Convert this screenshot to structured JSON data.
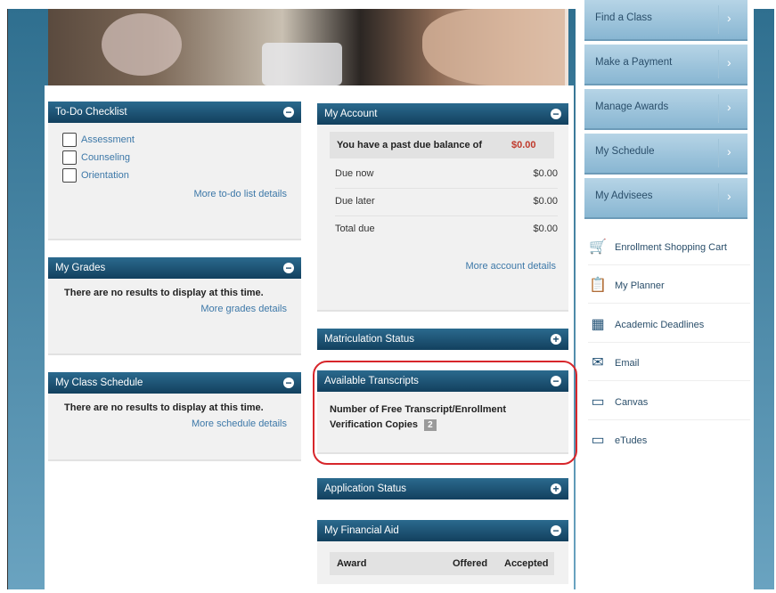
{
  "nav_buttons": [
    {
      "label": "Find a Class"
    },
    {
      "label": "Make a Payment"
    },
    {
      "label": "Manage Awards"
    },
    {
      "label": "My Schedule"
    },
    {
      "label": "My Advisees"
    }
  ],
  "quick_links": [
    {
      "label": "Enrollment Shopping Cart",
      "icon": "cart-icon"
    },
    {
      "label": "My Planner",
      "icon": "planner-icon"
    },
    {
      "label": "Academic Deadlines",
      "icon": "calendar-icon"
    },
    {
      "label": "Email",
      "icon": "email-icon"
    },
    {
      "label": "Canvas",
      "icon": "monitor-icon"
    },
    {
      "label": "eTudes",
      "icon": "monitor-icon"
    }
  ],
  "todo": {
    "title": "To-Do Checklist",
    "items": [
      "Assessment",
      "Counseling",
      "Orientation"
    ],
    "more": "More to-do list details"
  },
  "grades": {
    "title": "My Grades",
    "empty": "There are no results to display at this time.",
    "more": "More grades details"
  },
  "class_schedule": {
    "title": "My Class Schedule",
    "empty": "There are no results to display at this time.",
    "more": "More schedule details"
  },
  "account": {
    "title": "My Account",
    "past_due_text": "You have a past due balance of",
    "past_due_amount": "$0.00",
    "rows": [
      {
        "label": "Due now",
        "amount": "$0.00"
      },
      {
        "label": "Due later",
        "amount": "$0.00"
      },
      {
        "label": "Total due",
        "amount": "$0.00"
      }
    ],
    "more": "More account details"
  },
  "matriculation": {
    "title": "Matriculation Status"
  },
  "transcripts": {
    "title": "Available Transcripts",
    "text": "Number of Free Transcript/Enrollment Verification Copies",
    "count": "2"
  },
  "application": {
    "title": "Application Status"
  },
  "financial_aid": {
    "title": "My Financial Aid",
    "columns": [
      "Award",
      "Offered",
      "Accepted"
    ]
  },
  "colors": {
    "header": "#1b4f72",
    "link": "#3d78a8",
    "highlight": "#d7262b",
    "due": "#c0392b"
  }
}
